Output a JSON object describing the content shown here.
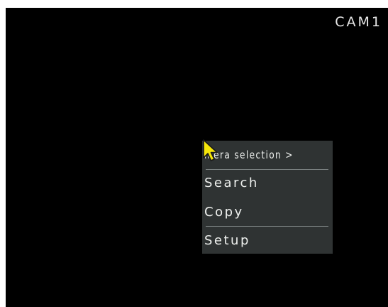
{
  "screen": {
    "camera_label": "CAM1"
  },
  "menu": {
    "items": [
      {
        "label": "mera selection >"
      },
      {
        "label": "Search"
      },
      {
        "label": "Copy"
      },
      {
        "label": "Setup"
      }
    ]
  },
  "cursor": {
    "icon": "arrow-cursor-icon",
    "color": "#f5e60a"
  },
  "colors": {
    "background": "#000000",
    "menu_background": "#2f3333",
    "text": "#eef0ee"
  }
}
